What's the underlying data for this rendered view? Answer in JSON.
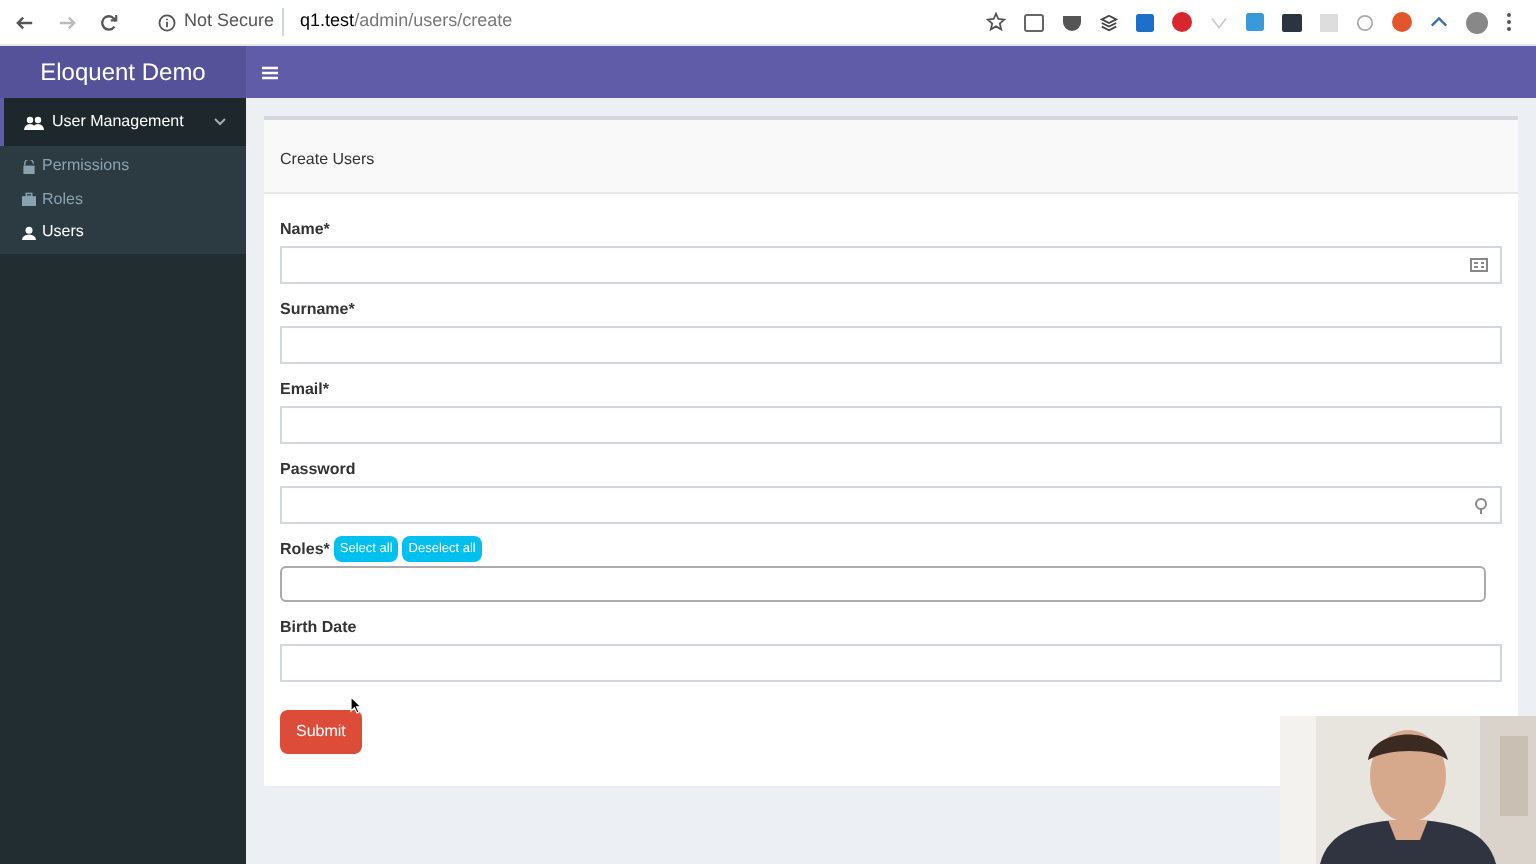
{
  "browser": {
    "security": "Not Secure",
    "url_host": "q1.test",
    "url_path": "/admin/users/create"
  },
  "app": {
    "title": "Eloquent Demo"
  },
  "sidebar": {
    "items": [
      {
        "label": "User Management",
        "expanded": true,
        "children": [
          {
            "label": "Permissions",
            "selected": false
          },
          {
            "label": "Roles",
            "selected": false
          },
          {
            "label": "Users",
            "selected": true
          }
        ]
      }
    ]
  },
  "form": {
    "title": "Create Users",
    "fields": [
      {
        "kind": "autofill",
        "label": "Name*"
      },
      {
        "kind": "text",
        "label": "Surname*"
      },
      {
        "kind": "text",
        "label": "Email*"
      },
      {
        "kind": "password",
        "label": "Password"
      },
      {
        "kind": "select",
        "label": "Roles*",
        "buttons": [
          "Select all",
          "Deselect all"
        ]
      },
      {
        "kind": "text",
        "label": "Birth Date"
      }
    ],
    "submit": "Submit"
  }
}
